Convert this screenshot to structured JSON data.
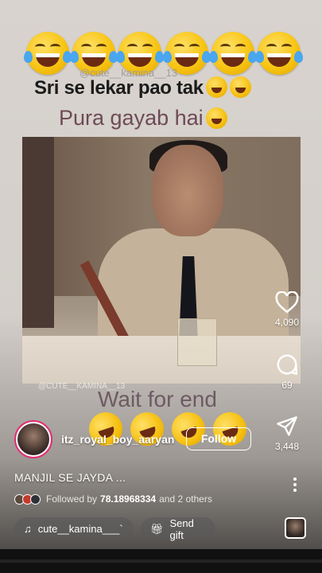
{
  "overlay": {
    "watermark_top": "@cute__kamina__13",
    "headline": "Sri se lekar pao tak",
    "subline": "Pura gayab hai",
    "video_watermark": "@CUTE__KAMINA__13",
    "wait_text": "Wait for end"
  },
  "reel": {
    "username": "itz_royal_boy_aaryan",
    "follow_label": "Follow",
    "caption": "MANJIL SE JAYDA ...",
    "followed_by_prefix": "Followed by",
    "followed_by_name": "78.18968334",
    "followed_by_suffix": "and 2 others"
  },
  "actions": {
    "like_count": "4,090",
    "comment_count": "69",
    "share_count": "3,448"
  },
  "bottom": {
    "audio_label": "cute__kamina___`",
    "gift_label": "Send gift"
  },
  "icons": [
    "heart-icon",
    "comment-icon",
    "share-icon",
    "more-icon",
    "music-note-icon",
    "gift-icon"
  ],
  "colors": {
    "avatar_ring": "#e12e72",
    "text": "#ffffff"
  }
}
